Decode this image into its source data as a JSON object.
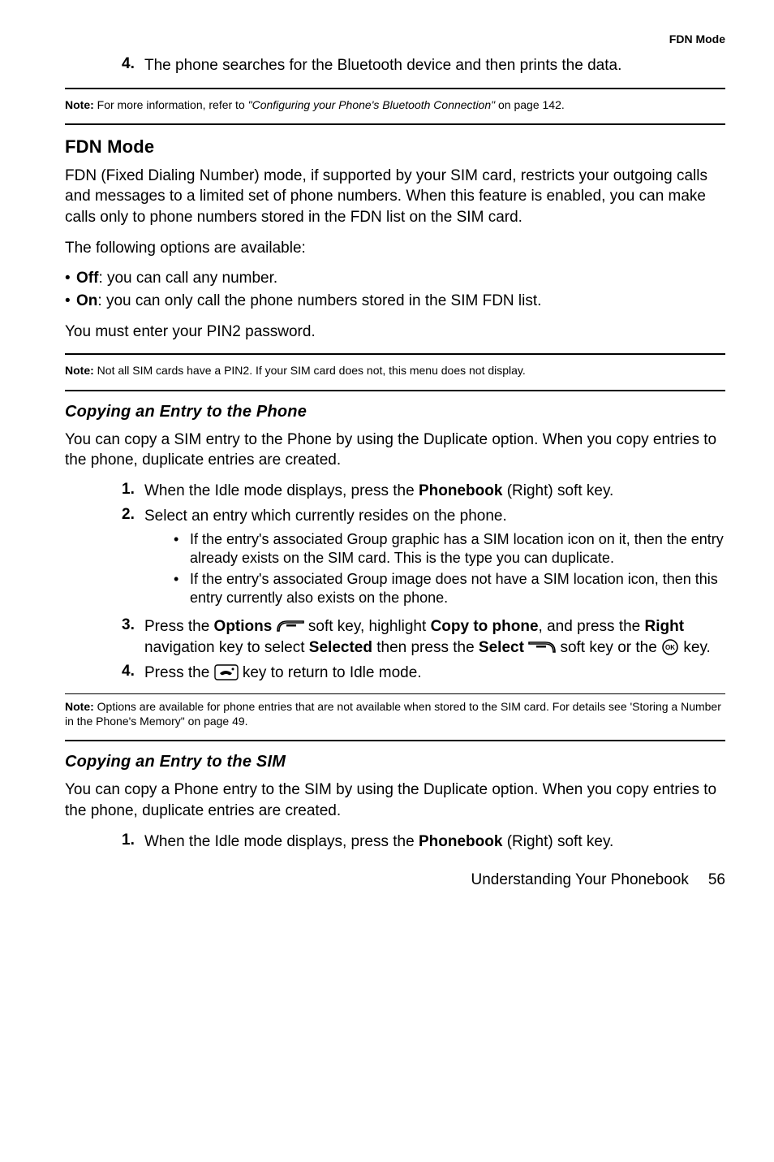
{
  "runhead": "FDN Mode",
  "top_step": {
    "num": "4.",
    "text": "The phone searches for the Bluetooth device and then prints the data."
  },
  "note1": {
    "label": "Note:",
    "lead": " For more information, refer to ",
    "italic": "\"Configuring your Phone's Bluetooth Connection\"",
    "tail": "  on page 142."
  },
  "section1": {
    "heading": "FDN Mode",
    "p1": "FDN (Fixed Dialing Number) mode, if supported by your SIM card, restricts your outgoing calls and messages to a limited set of phone numbers. When this feature is enabled, you can make calls only to phone numbers stored in the FDN list on the SIM card.",
    "p2": "The following options are available:",
    "bullets": [
      {
        "bold": "Off",
        "rest": ": you can call any number."
      },
      {
        "bold": "On",
        "rest": ": you can only call the phone numbers stored in the SIM FDN list."
      }
    ],
    "p3": "You must enter your PIN2 password."
  },
  "note2": {
    "label": "Note:",
    "text": " Not all SIM cards have a PIN2. If your SIM card does not, this menu does not display."
  },
  "section2": {
    "heading": "Copying an Entry to the Phone",
    "p1": "You can copy a SIM entry to the Phone by using the Duplicate option. When you copy entries to the phone, duplicate entries are created.",
    "steps": {
      "s1": {
        "num": "1.",
        "pre": "When the Idle mode displays, press the ",
        "bold": "Phonebook",
        "post": " (Right) soft key."
      },
      "s2": {
        "num": "2.",
        "text": "Select an entry which currently resides on the phone.",
        "subs": [
          "If the entry's associated Group graphic has a SIM location icon on it, then the entry already exists on the SIM card. This is the type you can duplicate.",
          "If the entry's associated Group image does not have a SIM location icon, then this entry currently also exists on the phone."
        ]
      },
      "s3": {
        "num": "3.",
        "a": "Press the ",
        "b": "Options",
        "c": " soft key, highlight ",
        "d": "Copy to phone",
        "e": ", and press the ",
        "f": "Right",
        "g": " navigation key to select ",
        "h": "Selected",
        "i": " then press the ",
        "j": "Select",
        "k": " soft key or the ",
        "l": " key."
      },
      "s4": {
        "num": "4.",
        "a": "Press the ",
        "b": " key to return to Idle mode."
      }
    }
  },
  "note3": {
    "label": "Note:",
    "text": " Options are available for phone entries that are not available when stored to the SIM card. For details see 'Storing a Number in the Phone's Memory\" on page 49."
  },
  "section3": {
    "heading": "Copying an Entry to the SIM",
    "p1": "You can copy a Phone entry to the SIM by using the Duplicate option. When you copy entries to the phone, duplicate entries are created.",
    "s1": {
      "num": "1.",
      "pre": "When the Idle mode displays, press the ",
      "bold": "Phonebook",
      "post": " (Right) soft key."
    }
  },
  "footer": {
    "section": "Understanding Your Phonebook",
    "page": "56"
  }
}
